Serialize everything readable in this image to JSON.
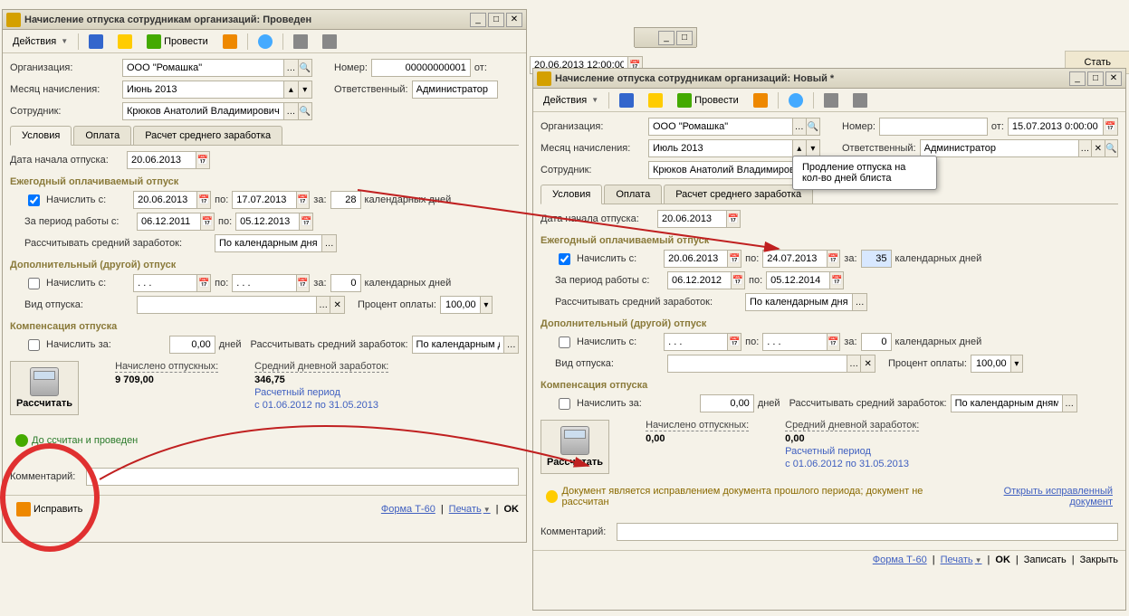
{
  "right_button": "Стать",
  "tooltip": "Продление отпуска на кол-во дней блиста",
  "common": {
    "labels": {
      "org": "Организация:",
      "month": "Месяц начисления:",
      "employee": "Сотрудник:",
      "number": "Номер:",
      "from": "от:",
      "responsible": "Ответственный:",
      "start_date": "Дата начала отпуска:",
      "accrue_from": "Начислить с:",
      "to": "по:",
      "for": "за:",
      "cal_days": "календарных дней",
      "work_period": "За период работы с:",
      "calc_avg": "Рассчитывать средний заработок:",
      "vac_type": "Вид отпуска:",
      "percent": "Процент оплаты:",
      "accrue_for": "Начислить за:",
      "days": "дней",
      "comment": "Комментарий:",
      "calc_btn": "Рассчитать",
      "accrued": "Начислено отпускных:",
      "avg_daily": "Средний дневной заработок:",
      "calc_period": "Расчетный период",
      "form": "Форма Т-60",
      "print": "Печать",
      "ok": "OK",
      "save": "Записать",
      "close": "Закрыть",
      "fix": "Исправить",
      "open_fixed": "Открыть исправленный документ"
    },
    "tabs": [
      "Условия",
      "Оплата",
      "Расчет среднего заработка"
    ],
    "sections": {
      "annual": "Ежегодный оплачиваемый отпуск",
      "additional": "Дополнительный (другой) отпуск",
      "compensation": "Компенсация отпуска"
    },
    "toolbar": {
      "actions": "Действия",
      "process": "Провести"
    },
    "avg_method": "По календарным дня...",
    "avg_method_full": "По календарным дням ..."
  },
  "win1": {
    "title": "Начисление отпуска сотрудникам организаций: Проведен",
    "org": "ООО \"Ромашка\"",
    "month": "Июнь 2013",
    "employee": "Крюков Анатолий Владимирович",
    "number": "00000000001",
    "date": "20.06.2013 12:00:00",
    "responsible": "Администратор",
    "start_date": "20.06.2013",
    "annual": {
      "from": "20.06.2013",
      "to": "17.07.2013",
      "days": "28",
      "period_from": "06.12.2011",
      "period_to": "05.12.2013"
    },
    "additional": {
      "from": ". . .",
      "to": ". . .",
      "days": "0",
      "percent": "100,00"
    },
    "comp": {
      "days": "0,00"
    },
    "summary": {
      "accrued": "9 709,00",
      "avg": "346,75",
      "period": "с 01.06.2012 по 31.05.2013"
    },
    "status": "До        ссчитан и проведен"
  },
  "win2": {
    "title": "Начисление отпуска сотрудникам организаций: Новый *",
    "org": "ООО \"Ромашка\"",
    "month": "Июль 2013",
    "employee": "Крюков Анатолий Владимирович",
    "date": "15.07.2013 0:00:00",
    "responsible": "Администратор",
    "start_date": "20.06.2013",
    "annual": {
      "from": "20.06.2013",
      "to": "24.07.2013",
      "days": "35",
      "period_from": "06.12.2012",
      "period_to": "05.12.2014"
    },
    "additional": {
      "from": ". . .",
      "to": ". . .",
      "days": "0",
      "percent": "100,00"
    },
    "comp": {
      "days": "0,00"
    },
    "summary": {
      "accrued": "0,00",
      "avg": "0,00",
      "period": "с 01.06.2012 по 31.05.2013"
    },
    "status": "Документ является исправлением документа прошлого периода; документ не рассчитан"
  }
}
